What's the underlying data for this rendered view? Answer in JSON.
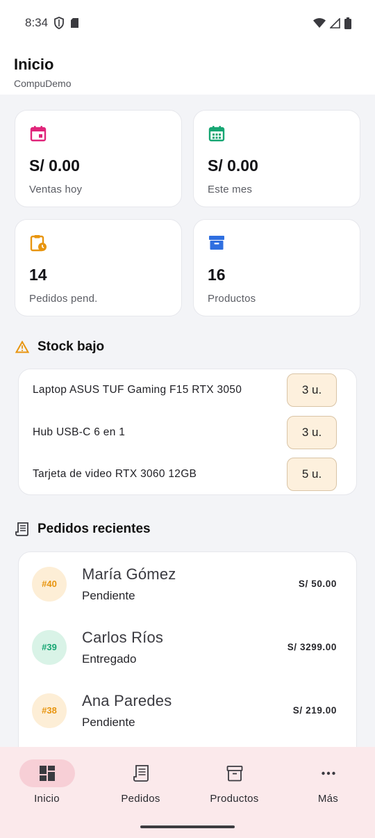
{
  "status_bar": {
    "time": "8:34"
  },
  "header": {
    "title": "Inicio",
    "subtitle": "CompuDemo"
  },
  "stats": [
    {
      "value": "S/ 0.00",
      "label": "Ventas hoy",
      "icon": "calendar-icon",
      "color": "#e0257a"
    },
    {
      "value": "S/ 0.00",
      "label": "Este mes",
      "icon": "calendar-month-icon",
      "color": "#17a673"
    },
    {
      "value": "14",
      "label": "Pedidos pend.",
      "icon": "clipboard-clock-icon",
      "color": "#e8950f"
    },
    {
      "value": "16",
      "label": "Productos",
      "icon": "archive-box-icon",
      "color": "#2f6fe0"
    }
  ],
  "low_stock": {
    "title": "Stock bajo",
    "items": [
      {
        "name": "Laptop ASUS TUF Gaming F15 RTX 3050",
        "qty": "3 u."
      },
      {
        "name": "Hub USB-C 6 en 1",
        "qty": "3 u."
      },
      {
        "name": "Tarjeta de video RTX 3060 12GB",
        "qty": "5 u."
      }
    ]
  },
  "recent_orders": {
    "title": "Pedidos recientes",
    "items": [
      {
        "id": "#40",
        "customer": "María Gómez",
        "status": "Pendiente",
        "amount": "S/ 50.00",
        "color": "#e8950f",
        "bg": "#fdeed6"
      },
      {
        "id": "#39",
        "customer": "Carlos Ríos",
        "status": "Entregado",
        "amount": "S/ 3299.00",
        "color": "#17a673",
        "bg": "#d9f3e7"
      },
      {
        "id": "#38",
        "customer": "Ana Paredes",
        "status": "Pendiente",
        "amount": "S/ 219.00",
        "color": "#e8950f",
        "bg": "#fdeed6"
      }
    ]
  },
  "bottom_nav": [
    {
      "label": "Inicio",
      "icon": "dashboard-icon",
      "active": true
    },
    {
      "label": "Pedidos",
      "icon": "receipt-icon",
      "active": false
    },
    {
      "label": "Productos",
      "icon": "archive-icon",
      "active": false
    },
    {
      "label": "Más",
      "icon": "more-horizontal-icon",
      "active": false
    }
  ]
}
